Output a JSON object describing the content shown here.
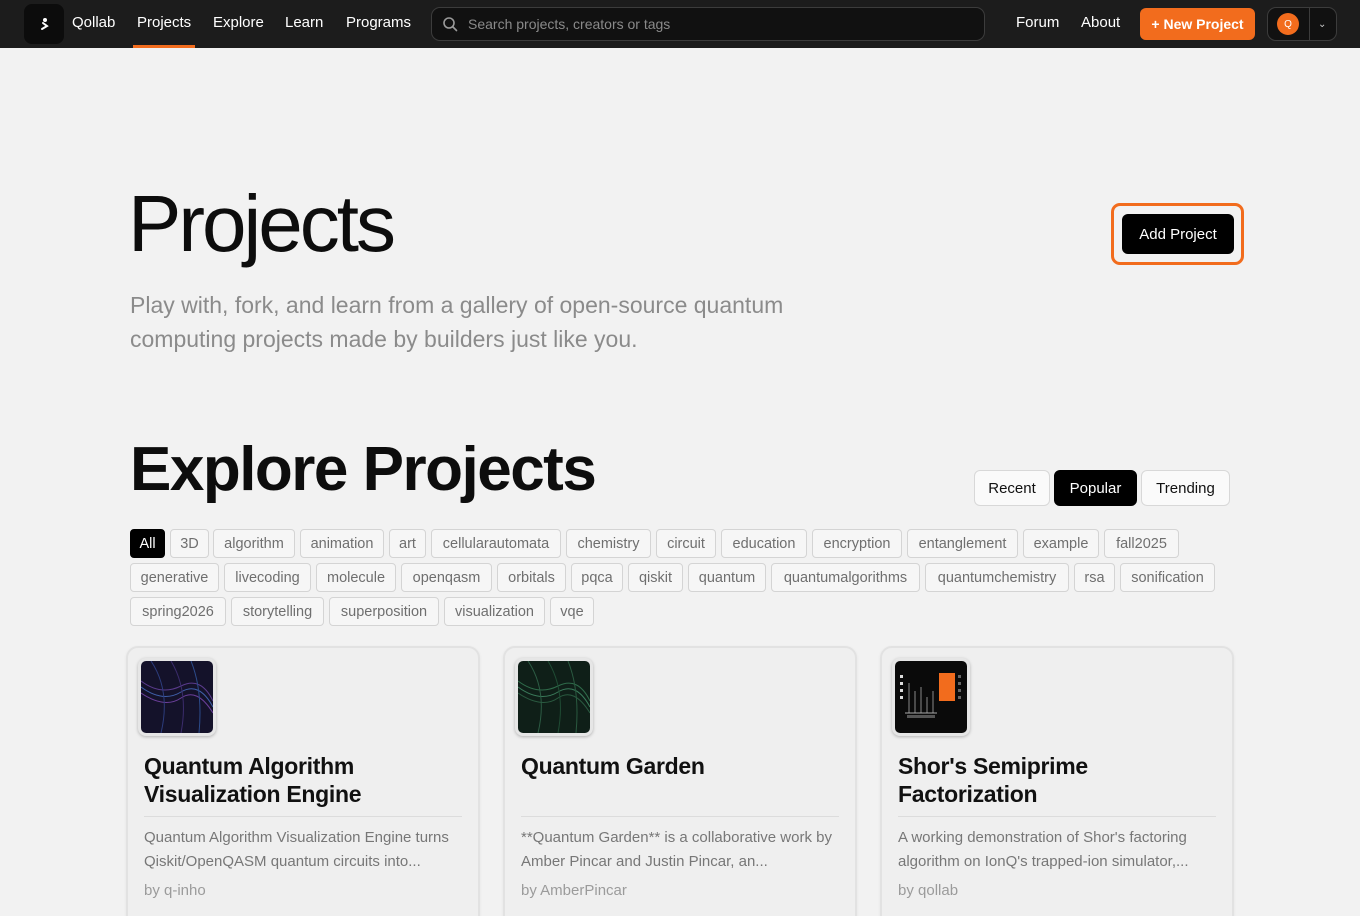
{
  "nav": {
    "brand": "Qollab",
    "links": [
      "Projects",
      "Explore",
      "Learn",
      "Programs"
    ],
    "search_placeholder": "Search projects, creators or tags",
    "right_links": [
      "Forum",
      "About"
    ],
    "new_project": "+ New Project",
    "avatar_initial": "Q",
    "accent_color": "#f26c1d"
  },
  "hero": {
    "title": "Projects",
    "subtitle": "Play with, fork, and learn from a gallery of open-source quantum computing projects made by builders just like you.",
    "add_button": "Add Project"
  },
  "explore": {
    "title": "Explore Projects",
    "sort_options": [
      "Recent",
      "Popular",
      "Trending"
    ],
    "active_sort": "Popular",
    "tags": [
      "All",
      "3D",
      "algorithm",
      "animation",
      "art",
      "cellularautomata",
      "chemistry",
      "circuit",
      "education",
      "encryption",
      "entanglement",
      "example",
      "fall2025",
      "generative",
      "livecoding",
      "molecule",
      "openqasm",
      "orbitals",
      "pqca",
      "qiskit",
      "quantum",
      "quantumalgorithms",
      "quantumchemistry",
      "rsa",
      "sonification",
      "spring2026",
      "storytelling",
      "superposition",
      "visualization",
      "vqe"
    ],
    "active_tag": "All"
  },
  "cards": [
    {
      "title": "Quantum Algorithm Visualization Engine",
      "description": "Quantum Algorithm Visualization Engine turns Qiskit/OpenQASM quantum circuits into...",
      "author": "by q-inho"
    },
    {
      "title": "Quantum Garden",
      "description": "**Quantum Garden** is a collaborative work by Amber Pincar and Justin Pincar, an...",
      "author": "by AmberPincar"
    },
    {
      "title": "Shor's Semiprime Factorization",
      "description": "A working demonstration of Shor's factoring algorithm on IonQ's trapped-ion simulator,...",
      "author": "by qollab"
    }
  ]
}
